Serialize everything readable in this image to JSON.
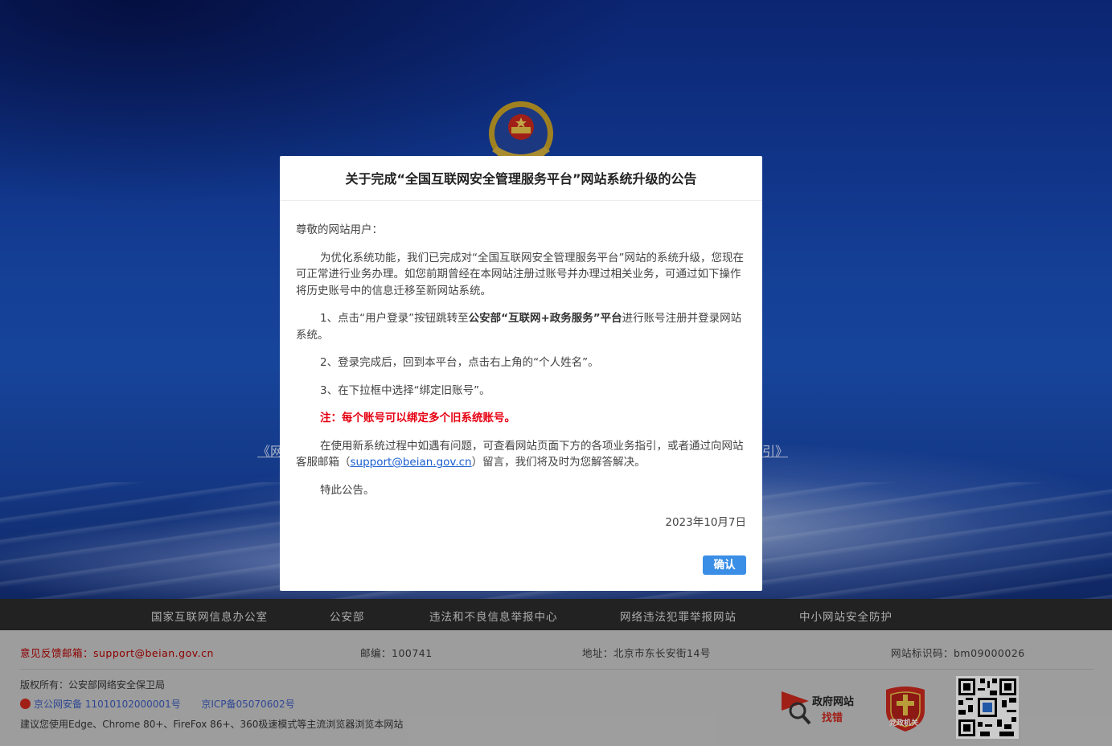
{
  "modal": {
    "title": "关于完成“全国互联网安全管理服务平台”网站系统升级的公告",
    "greeting": "尊敬的网站用户：",
    "para1": "为优化系统功能，我们已完成对“全国互联网安全管理服务平台”网站的系统升级，您现在可正常进行业务办理。如您前期曾经在本网站注册过账号并办理过相关业务，可通过如下操作将历史账号中的信息迁移至新网站系统。",
    "step1_prefix": "1、点击“用户登录”按钮跳转至",
    "step1_bold": "公安部“互联网+政务服务”平台",
    "step1_suffix": "进行账号注册并登录网站系统。",
    "step2": "2、登录完成后，回到本平台，点击右上角的“个人姓名”。",
    "step3": "3、在下拉框中选择“绑定旧账号”。",
    "note": "注：每个账号可以绑定多个旧系统账号。",
    "help_prefix": "在使用新系统过程中如遇有问题，可查看网站页面下方的各项业务指引，或者通过向网站客服邮箱（",
    "help_email": "support@beian.gov.cn",
    "help_suffix": "）留言，我们将及时为您解答解决。",
    "closing": "特此公告。",
    "date": "2023年10月7日",
    "confirm_label": "确认"
  },
  "background": {
    "guide_left": "《网",
    "guide_right": "引》"
  },
  "link_bar": {
    "items": [
      "国家互联网信息办公室",
      "公安部",
      "违法和不良信息举报中心",
      "网络违法犯罪举报网站",
      "中小网站安全防护"
    ]
  },
  "footer": {
    "feedback": "意见反馈邮箱：support@beian.gov.cn",
    "postcode": "邮编：100741",
    "address": "地址：北京市东长安街14号",
    "site_code": "网站标识码：bm09000026",
    "copyright": "版权所有：公安部网络安全保卫局",
    "police_record": "京公网安备 11010102000001号",
    "icp_record": "京ICP备05070602号",
    "browser_tip": "建议您使用Edge、Chrome 80+、FireFox 86+、360极速模式等主流浏览器浏览本网站",
    "gov_logo_line1": "政府网站",
    "gov_logo_line2": "找错",
    "party_logo_text": "党政机关"
  },
  "colors": {
    "accent_button": "#3a8ee6",
    "warning": "#e60012",
    "link": "#1a5fd0",
    "footer_bar": "#2b2b2b",
    "footer_bg": "#c5c5c5"
  }
}
